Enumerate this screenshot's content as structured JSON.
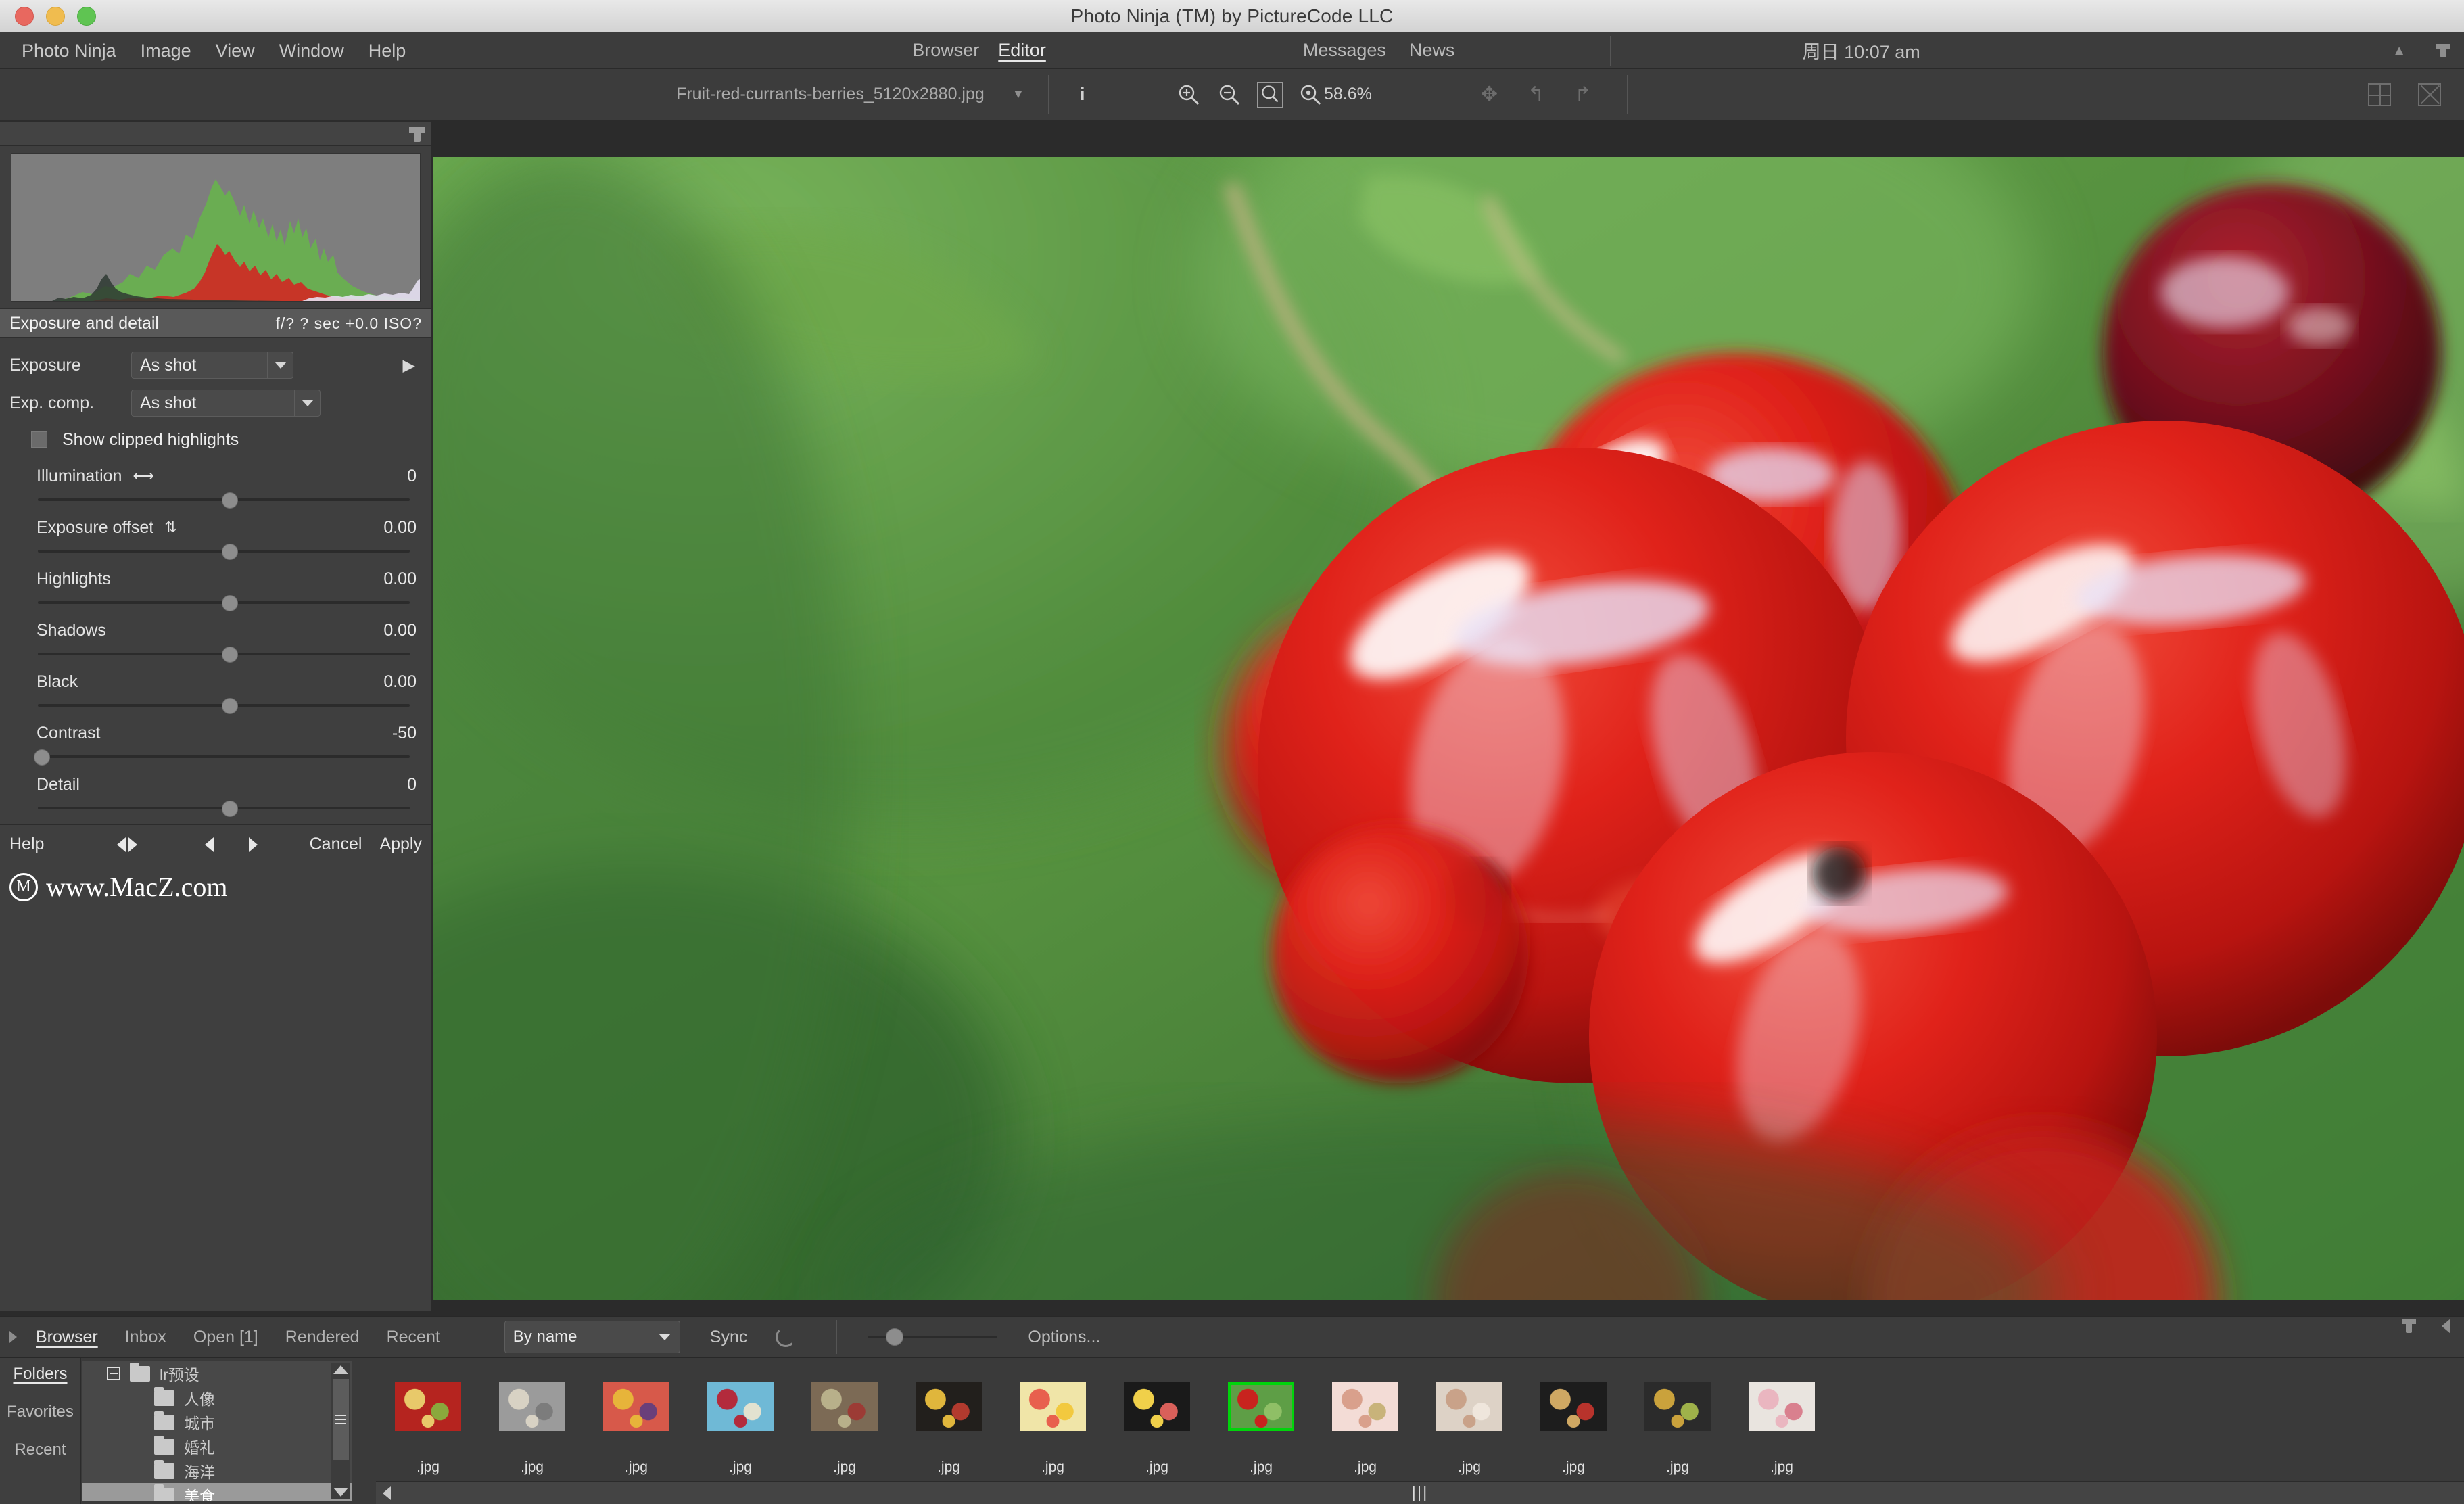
{
  "window": {
    "title": "Photo Ninja (TM) by PictureCode LLC",
    "traffic": [
      "close",
      "minimize",
      "zoom"
    ]
  },
  "menubar": {
    "items": [
      "Photo Ninja",
      "Image",
      "View",
      "Window",
      "Help"
    ],
    "mode_tabs": [
      {
        "label": "Browser",
        "active": false
      },
      {
        "label": "Editor",
        "active": true
      }
    ],
    "message_tabs": [
      "Messages",
      "News"
    ],
    "clock": "周日 10:07 am"
  },
  "toolbar": {
    "filename": "Fruit-red-currants-berries_5120x2880.jpg",
    "info_glyph": "i",
    "zoom_in": "zoom-in-icon",
    "zoom_out": "zoom-out-icon",
    "zoom_fit": "zoom-fit-icon",
    "zoom_actual": "zoom-actual-icon",
    "zoom_value": "58.6%",
    "pan": "pan-icon",
    "undo": "undo-icon",
    "redo": "redo-icon",
    "split_view": "split-view-icon",
    "close_view": "close-view-icon"
  },
  "left_panel": {
    "section_title": "Exposure and detail",
    "exif": "f/?  ? sec  +0.0  ISO?",
    "exposure": {
      "label": "Exposure",
      "value": "As shot"
    },
    "exp_comp": {
      "label": "Exp. comp.",
      "value": "As shot"
    },
    "show_clipped": {
      "label": "Show clipped highlights",
      "checked": false
    },
    "sliders": [
      {
        "name": "Illumination",
        "value": "0",
        "icon": "horizontal-arrows-icon",
        "pos": 50
      },
      {
        "name": "Exposure offset",
        "value": "0.00",
        "icon": "expand-arrows-icon",
        "pos": 50
      },
      {
        "name": "Highlights",
        "value": "0.00",
        "icon": "",
        "pos": 50
      },
      {
        "name": "Shadows",
        "value": "0.00",
        "icon": "",
        "pos": 50
      },
      {
        "name": "Black",
        "value": "0.00",
        "icon": "",
        "pos": 50
      },
      {
        "name": "Contrast",
        "value": "-50",
        "icon": "",
        "pos": 1
      },
      {
        "name": "Detail",
        "value": "0",
        "icon": "",
        "pos": 50
      }
    ],
    "buttons": {
      "help": "Help",
      "cancel": "Cancel",
      "apply": "Apply"
    }
  },
  "watermark": {
    "mark": "M",
    "text": "www.MacZ.com"
  },
  "browser_bar": {
    "tabs": [
      {
        "label": "Browser",
        "active": true
      },
      {
        "label": "Inbox",
        "active": false
      },
      {
        "label": "Open [1]",
        "active": false
      },
      {
        "label": "Rendered",
        "active": false
      },
      {
        "label": "Recent",
        "active": false
      }
    ],
    "sort": "By name",
    "sync": "Sync",
    "refresh": "refresh-icon",
    "options": "Options..."
  },
  "folders_panel": {
    "nav": [
      {
        "label": "Folders",
        "active": true
      },
      {
        "label": "Favorites",
        "active": false
      },
      {
        "label": "Recent",
        "active": false
      }
    ],
    "tree": [
      {
        "label": "lr预设",
        "depth": 0,
        "expander": true,
        "selected": false
      },
      {
        "label": "人像",
        "depth": 1,
        "expander": false,
        "selected": false
      },
      {
        "label": "城市",
        "depth": 1,
        "expander": false,
        "selected": false
      },
      {
        "label": "婚礼",
        "depth": 1,
        "expander": false,
        "selected": false
      },
      {
        "label": "海洋",
        "depth": 1,
        "expander": false,
        "selected": false
      },
      {
        "label": "美食",
        "depth": 1,
        "expander": false,
        "selected": true
      }
    ]
  },
  "filmstrip": {
    "items": [
      {
        "label": ".jpg",
        "selected": false,
        "c1": "#b5241f",
        "c2": "#e8c96a",
        "c3": "#8aa83c"
      },
      {
        "label": ".jpg",
        "selected": false,
        "c1": "#9b9b9b",
        "c2": "#d8d2c4",
        "c3": "#7c7c7c"
      },
      {
        "label": ".jpg",
        "selected": false,
        "c1": "#d7594a",
        "c2": "#e7b43a",
        "c3": "#6a3f7a"
      },
      {
        "label": ".jpg",
        "selected": false,
        "c1": "#6fb9d6",
        "c2": "#b32b3c",
        "c3": "#e2e2d0"
      },
      {
        "label": ".jpg",
        "selected": false,
        "c1": "#7c6a55",
        "c2": "#b8b08a",
        "c3": "#9c3b35"
      },
      {
        "label": ".jpg",
        "selected": false,
        "c1": "#221f1c",
        "c2": "#e0b63c",
        "c3": "#b23a2e"
      },
      {
        "label": ".jpg",
        "selected": false,
        "c1": "#f0e5a8",
        "c2": "#e8604e",
        "c3": "#f2c93f"
      },
      {
        "label": ".jpg",
        "selected": false,
        "c1": "#1a1a1a",
        "c2": "#f0d04a",
        "c3": "#d9605a"
      },
      {
        "label": ".jpg",
        "selected": true,
        "c1": "#5e9e46",
        "c2": "#c8231e",
        "c3": "#8fbf66"
      },
      {
        "label": ".jpg",
        "selected": false,
        "c1": "#f3dcd6",
        "c2": "#d9a08c",
        "c3": "#c8b37a"
      },
      {
        "label": ".jpg",
        "selected": false,
        "c1": "#ddd2c6",
        "c2": "#c9a289",
        "c3": "#efe6dc"
      },
      {
        "label": ".jpg",
        "selected": false,
        "c1": "#1d1d1d",
        "c2": "#cfa863",
        "c3": "#b8332c"
      },
      {
        "label": ".jpg",
        "selected": false,
        "c1": "#2b2b2b",
        "c2": "#caa23c",
        "c3": "#9fb24a"
      },
      {
        "label": ".jpg",
        "selected": false,
        "c1": "#e9e4df",
        "c2": "#eab6c0",
        "c3": "#d9808e"
      }
    ]
  },
  "image": {
    "alt": "macro photo of red currant berries on green background",
    "bg_green": "#5c9e46",
    "berry_red": "#d8241b",
    "stem": "#b9b27f"
  }
}
